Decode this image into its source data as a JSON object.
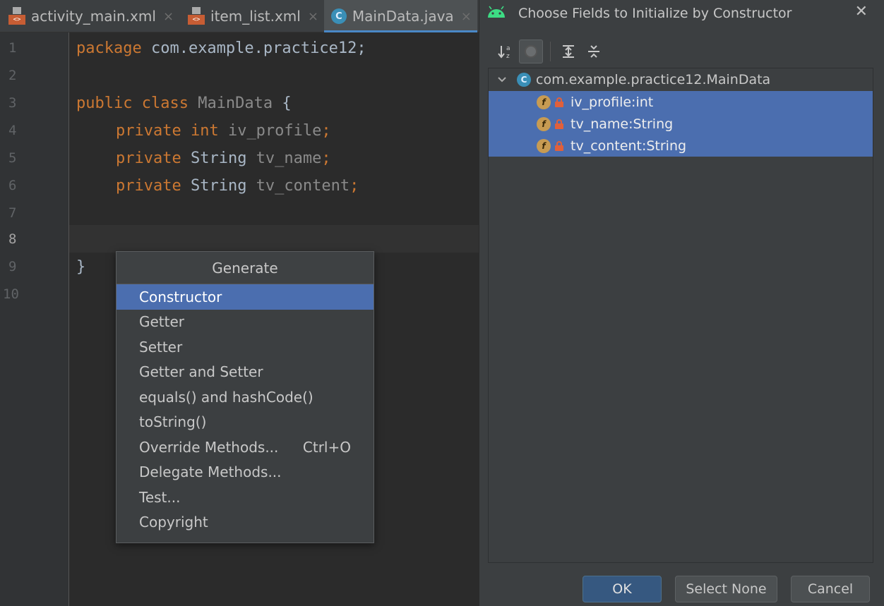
{
  "editor": {
    "tabs": [
      {
        "label": "activity_main.xml",
        "icon": "xml-file-icon",
        "active": false
      },
      {
        "label": "item_list.xml",
        "icon": "xml-file-icon",
        "active": false
      },
      {
        "label": "MainData.java",
        "icon": "java-class-icon",
        "active": true
      }
    ],
    "tab_close_glyph": "×",
    "xml_icon_text": "<>",
    "class_icon_text": "C",
    "line_numbers": [
      "1",
      "2",
      "3",
      "4",
      "5",
      "6",
      "7",
      "8",
      "9",
      "10"
    ],
    "current_line": "8",
    "code": {
      "line1": {
        "kw": "package",
        "rest": " com.example.practice12;"
      },
      "line3": {
        "kw": "public class",
        "name": " MainData",
        "brace": " {"
      },
      "line4": {
        "kw": "private int",
        "name": " iv_profile",
        "semi": ";"
      },
      "line5": {
        "kw": "private",
        "type": " String",
        "name": " tv_name",
        "semi": ";"
      },
      "line6": {
        "kw": "private",
        "type": " String",
        "name": " tv_content",
        "semi": ";"
      },
      "line9": "}"
    }
  },
  "generate_popup": {
    "title": "Generate",
    "items": [
      {
        "label": "Constructor",
        "shortcut": "",
        "selected": true
      },
      {
        "label": "Getter",
        "shortcut": ""
      },
      {
        "label": "Setter",
        "shortcut": ""
      },
      {
        "label": "Getter and Setter",
        "shortcut": ""
      },
      {
        "label": "equals() and hashCode()",
        "shortcut": ""
      },
      {
        "label": "toString()",
        "shortcut": ""
      },
      {
        "label": "Override Methods...",
        "shortcut": "Ctrl+O"
      },
      {
        "label": "Delegate Methods...",
        "shortcut": ""
      },
      {
        "label": "Test...",
        "shortcut": ""
      },
      {
        "label": "Copyright",
        "shortcut": ""
      }
    ]
  },
  "dialog": {
    "title": "Choose Fields to Initialize by Constructor",
    "close_glyph": "✕",
    "toolbar": {
      "sort_label": "↓a z",
      "sort_icon": "sort-alphabetically-icon",
      "show_classes_icon": "show-classes-icon",
      "expand_all_icon": "expand-all-icon",
      "collapse_all_icon": "collapse-all-icon",
      "expand_glyph": "⇕",
      "collapse_glyph": "÷"
    },
    "tree": {
      "root_label": "com.example.practice12.MainData",
      "root_chevron": "⌄",
      "field_icon_text": "f",
      "fields": [
        {
          "label": "iv_profile:int",
          "selected": true
        },
        {
          "label": "tv_name:String",
          "selected": true
        },
        {
          "label": "tv_content:String",
          "selected": true
        }
      ]
    },
    "buttons": {
      "ok": "OK",
      "select_none": "Select None",
      "cancel": "Cancel"
    }
  },
  "colors": {
    "keyword": "#cc7832",
    "identifier": "#a9b7c6",
    "selection": "#4b6eaf",
    "background": "#2b2b2b",
    "panel": "#3c3f41"
  }
}
